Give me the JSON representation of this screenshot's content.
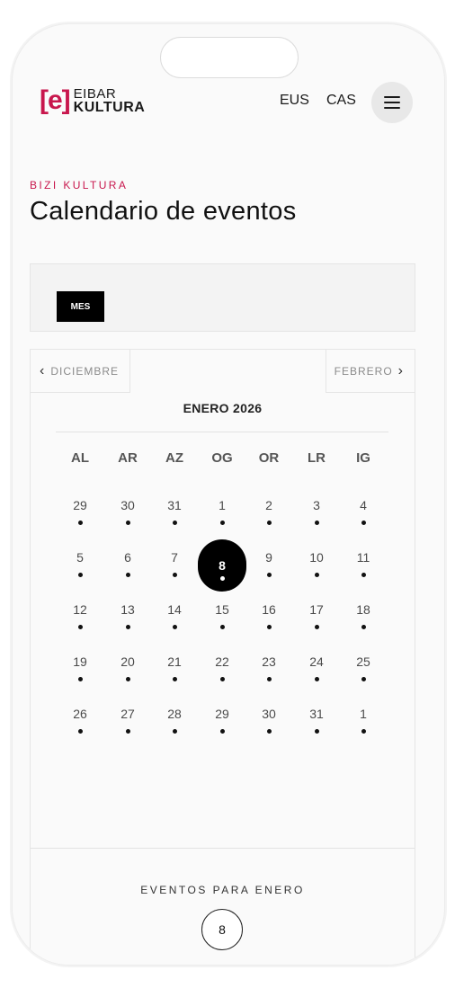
{
  "header": {
    "logo_mark": "[e]",
    "logo_line1": "EIBAR",
    "logo_line2": "KULTURA",
    "lang_eus": "EUS",
    "lang_cas": "CAS",
    "menu_icon": "hamburger-icon"
  },
  "page": {
    "eyebrow": "BIZI KULTURA",
    "title": "Calendario de eventos"
  },
  "view": {
    "mes_label": "MES"
  },
  "calendar": {
    "prev_label": "DICIEMBRE",
    "next_label": "FEBRERO",
    "prev_icon": "chevron-left-icon",
    "next_icon": "chevron-right-icon",
    "month_label": "ENERO 2026",
    "weekdays": [
      "AL",
      "AR",
      "AZ",
      "OG",
      "OR",
      "LR",
      "IG"
    ],
    "weeks": [
      [
        "29",
        "30",
        "31",
        "1",
        "2",
        "3",
        "4"
      ],
      [
        "5",
        "6",
        "7",
        "8",
        "9",
        "10",
        "11"
      ],
      [
        "12",
        "13",
        "14",
        "15",
        "16",
        "17",
        "18"
      ],
      [
        "19",
        "20",
        "21",
        "22",
        "23",
        "24",
        "25"
      ],
      [
        "26",
        "27",
        "28",
        "29",
        "30",
        "31",
        "1"
      ]
    ],
    "selected_day": "8"
  },
  "events": {
    "label": "EVENTOS PARA ENERO",
    "count": "8"
  },
  "colors": {
    "accent": "#c8174d",
    "selected_bg": "#000000"
  }
}
